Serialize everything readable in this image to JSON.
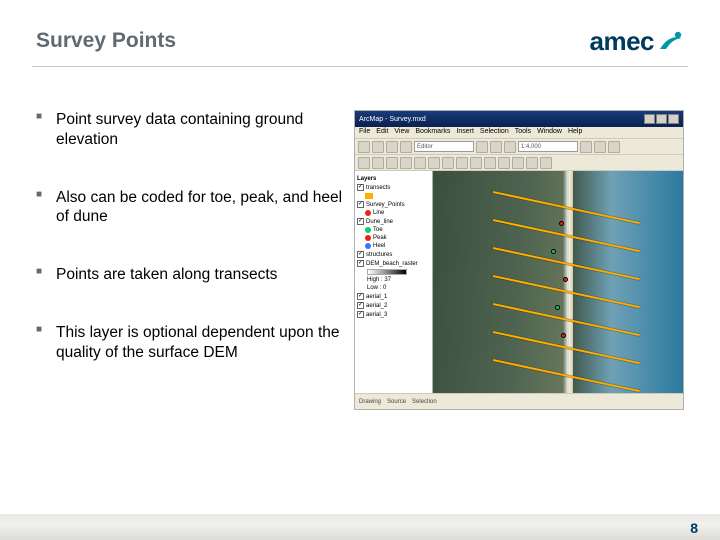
{
  "header": {
    "title": "Survey Points",
    "logo_text": "amec"
  },
  "bullets": [
    "Point survey data containing ground elevation",
    "Also can be coded for toe, peak, and heel of dune",
    "Points are taken along transects",
    "This layer is optional dependent upon the quality of the surface DEM"
  ],
  "screenshot": {
    "window_title": "ArcMap - Survey.mxd",
    "menu": [
      "File",
      "Edit",
      "View",
      "Bookmarks",
      "Insert",
      "Selection",
      "Tools",
      "Window",
      "Help"
    ],
    "toolbar_selects": [
      "Editor",
      "1:4,000"
    ],
    "toc": {
      "header": "Layers",
      "items": [
        {
          "label": "transects"
        },
        {
          "label": "Survey_Points"
        },
        {
          "label": "Line"
        },
        {
          "label": "Dune_line"
        },
        {
          "label": "Toe"
        },
        {
          "label": "Peak"
        },
        {
          "label": "Heel"
        },
        {
          "label": "structures"
        },
        {
          "label": "DEM_beach_raster"
        },
        {
          "label": "High : 37"
        },
        {
          "label": "Low : 0"
        },
        {
          "label": "aerial_1"
        },
        {
          "label": "aerial_2"
        },
        {
          "label": "aerial_3"
        }
      ]
    },
    "status": [
      "Drawing",
      "Source",
      "Selection"
    ]
  },
  "colors": {
    "title_gray": "#5f6a72",
    "brand_navy": "#003a5d",
    "brand_teal": "#0097a7",
    "transect_orange": "#ffae00"
  },
  "page_number": "8"
}
